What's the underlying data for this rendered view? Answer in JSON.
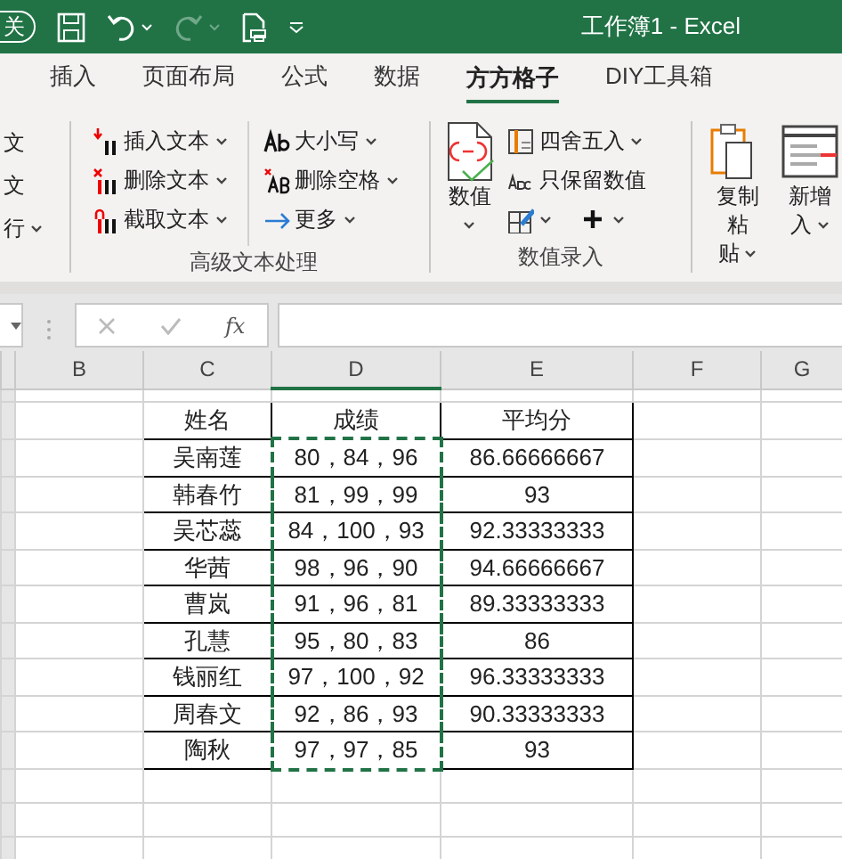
{
  "title_bar": {
    "autosave_label": "关",
    "title": "工作簿1  -  Excel"
  },
  "tabs": [
    {
      "label": "插入",
      "selected": false
    },
    {
      "label": "页面布局",
      "selected": false
    },
    {
      "label": "公式",
      "selected": false
    },
    {
      "label": "数据",
      "selected": false
    },
    {
      "label": "方方格子",
      "selected": true
    },
    {
      "label": "DIY工具箱",
      "selected": false
    }
  ],
  "ribbon": {
    "partial_items": [
      {
        "label": "文",
        "dropdown": false
      },
      {
        "label": "文",
        "dropdown": false
      },
      {
        "label": "行",
        "dropdown": true
      }
    ],
    "text_group": {
      "label": "高级文本处理",
      "items": [
        {
          "kind": "insert",
          "label": "插入文本",
          "dropdown": true
        },
        {
          "kind": "delete",
          "label": "删除文本",
          "dropdown": true
        },
        {
          "kind": "cut",
          "label": "截取文本",
          "dropdown": true
        },
        {
          "kind": "case",
          "label": "大小写",
          "dropdown": true
        },
        {
          "kind": "space",
          "label": "删除空格",
          "dropdown": true
        },
        {
          "kind": "more",
          "label": "更多",
          "dropdown": true
        }
      ]
    },
    "number_group": {
      "label": "数值录入",
      "big_button": {
        "label": "数值",
        "dropdown": true
      },
      "items": [
        {
          "kind": "round",
          "label": "四舍五入",
          "dropdown": true
        },
        {
          "kind": "keep",
          "label": "只保留数值",
          "dropdown": false
        },
        {
          "kind": "edit",
          "dropdown": true
        },
        {
          "kind": "plus",
          "dropdown": true
        }
      ]
    },
    "big_buttons": [
      {
        "kind": "paste",
        "lines": [
          "复制粘",
          "贴"
        ],
        "dropdown": true
      },
      {
        "kind": "insert",
        "lines": [
          "新增",
          "入"
        ],
        "dropdown": true
      }
    ]
  },
  "formula_bar": {
    "fx": "fx"
  },
  "sheet": {
    "columns": [
      {
        "label": "B",
        "marquee": false
      },
      {
        "label": "C",
        "marquee": false
      },
      {
        "label": "D",
        "marquee": true
      },
      {
        "label": "E",
        "marquee": false
      },
      {
        "label": "F",
        "marquee": false
      },
      {
        "label": "G",
        "marquee": false
      }
    ],
    "table": {
      "header": [
        "姓名",
        "成绩",
        "平均分"
      ],
      "rows": [
        [
          "吴南莲",
          "80，84，96",
          "86.66666667"
        ],
        [
          "韩春竹",
          "81，99，99",
          "93"
        ],
        [
          "吴芯蕊",
          "84，100，93",
          "92.33333333"
        ],
        [
          "华茜",
          "98，96，90",
          "94.66666667"
        ],
        [
          "曹岚",
          "91，96，81",
          "89.33333333"
        ],
        [
          "孔慧",
          "95，80，83",
          "86"
        ],
        [
          "钱丽红",
          "97，100，92",
          "96.33333333"
        ],
        [
          "周春文",
          "92，86，93",
          "90.33333333"
        ],
        [
          "陶秋",
          "97，97，85",
          "93"
        ]
      ]
    }
  }
}
